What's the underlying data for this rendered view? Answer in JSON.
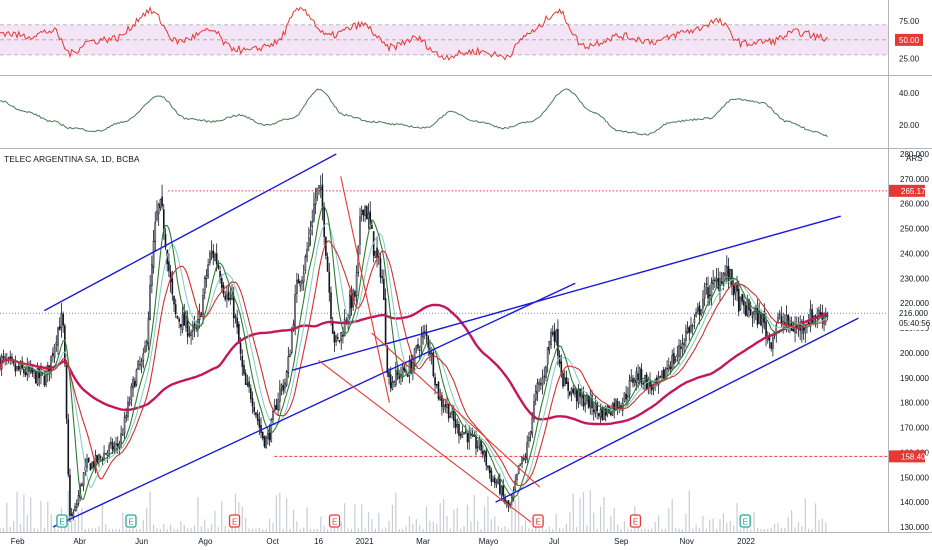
{
  "chart_data": {
    "type": "candlestick",
    "title": "TELEC ARGENTINA SA, 1D, BCBA",
    "currency": "ARS",
    "colors": {
      "up": "#26a69a",
      "down": "#131722",
      "sma_red": "#d32f2f",
      "sma_green": "#2e7d32",
      "sma_cyan": "#80cbc4",
      "sma_long": "#c2185b",
      "channel": "#1a1adb",
      "downtrend": "#e53935",
      "rsi_line": "#e53935",
      "rsi_band": "#f3e5f5",
      "adx": "#4a7a54",
      "label_red": "#e53935"
    },
    "x_axis": {
      "tick_labels": [
        "Feb",
        "Abr",
        "Jun",
        "Ago",
        "Oct",
        "16",
        "2021",
        "Mar",
        "Mayo",
        "Jul",
        "Sep",
        "Nov",
        "2022"
      ],
      "tick_positions": [
        0.02,
        0.09,
        0.16,
        0.232,
        0.308,
        0.36,
        0.412,
        0.478,
        0.552,
        0.626,
        0.702,
        0.776,
        0.843
      ]
    },
    "price_axis": {
      "ylim": [
        128,
        282
      ],
      "ticks": [
        280,
        270,
        260,
        250,
        240,
        230,
        220,
        210,
        200,
        190,
        180,
        170,
        160,
        150,
        140,
        130
      ],
      "tick_labels": [
        "280.000",
        "270.000",
        "260.000",
        "250.000",
        "240.000",
        "230.000",
        "220.000",
        "210.000",
        "200.000",
        "190.000",
        "180.000",
        "170.000",
        "160.000",
        "150.000",
        "140.000",
        "130.000"
      ]
    },
    "last_price": {
      "value": 216.0,
      "label": "216.000",
      "countdown": "05:40:56"
    },
    "levels": [
      {
        "value": 265.179,
        "label": "265.179",
        "style": "dotted"
      },
      {
        "value": 158.402,
        "label": "158.402",
        "style": "dashed"
      }
    ],
    "price_anchors": [
      [
        0.0,
        197
      ],
      [
        0.02,
        193
      ],
      [
        0.05,
        190
      ],
      [
        0.07,
        213
      ],
      [
        0.08,
        134
      ],
      [
        0.1,
        155
      ],
      [
        0.13,
        162
      ],
      [
        0.16,
        195
      ],
      [
        0.18,
        258
      ],
      [
        0.2,
        214
      ],
      [
        0.22,
        208
      ],
      [
        0.24,
        240
      ],
      [
        0.26,
        221
      ],
      [
        0.28,
        185
      ],
      [
        0.3,
        165
      ],
      [
        0.32,
        187
      ],
      [
        0.34,
        232
      ],
      [
        0.36,
        265
      ],
      [
        0.38,
        204
      ],
      [
        0.4,
        222
      ],
      [
        0.41,
        260
      ],
      [
        0.43,
        234
      ],
      [
        0.44,
        189
      ],
      [
        0.46,
        193
      ],
      [
        0.48,
        207
      ],
      [
        0.5,
        180
      ],
      [
        0.52,
        169
      ],
      [
        0.54,
        163
      ],
      [
        0.56,
        148
      ],
      [
        0.575,
        138
      ],
      [
        0.59,
        156
      ],
      [
        0.61,
        187
      ],
      [
        0.625,
        209
      ],
      [
        0.64,
        186
      ],
      [
        0.66,
        181
      ],
      [
        0.68,
        176
      ],
      [
        0.7,
        180
      ],
      [
        0.72,
        191
      ],
      [
        0.74,
        186
      ],
      [
        0.76,
        197
      ],
      [
        0.78,
        210
      ],
      [
        0.8,
        225
      ],
      [
        0.82,
        232
      ],
      [
        0.84,
        218
      ],
      [
        0.86,
        214
      ],
      [
        0.87,
        205
      ],
      [
        0.88,
        213
      ],
      [
        0.9,
        210
      ],
      [
        0.92,
        215
      ],
      [
        0.935,
        216
      ]
    ],
    "trend_lines": [
      {
        "name": "upper-channel-1",
        "from": [
          0.05,
          217
        ],
        "to": [
          0.38,
          280
        ]
      },
      {
        "name": "lower-channel-1",
        "from": [
          0.06,
          130
        ],
        "to": [
          0.65,
          228
        ]
      },
      {
        "name": "upper-channel-2",
        "from": [
          0.33,
          193
        ],
        "to": [
          0.95,
          255
        ]
      },
      {
        "name": "lower-channel-2",
        "from": [
          0.56,
          140
        ],
        "to": [
          0.97,
          214
        ]
      }
    ],
    "downtrend_lines": [
      {
        "from": [
          0.385,
          271
        ],
        "to": [
          0.44,
          180
        ]
      },
      {
        "from": [
          0.42,
          208
        ],
        "to": [
          0.61,
          146
        ]
      },
      {
        "from": [
          0.36,
          197
        ],
        "to": [
          0.6,
          132
        ]
      }
    ],
    "rsi": {
      "ticks": [
        75,
        50,
        25
      ],
      "tick_labels": [
        "75.00",
        "50.00",
        "25.00"
      ],
      "band": [
        70,
        30
      ],
      "mid": 50,
      "anchors": [
        [
          0.0,
          60
        ],
        [
          0.03,
          55
        ],
        [
          0.06,
          62
        ],
        [
          0.08,
          32
        ],
        [
          0.1,
          48
        ],
        [
          0.13,
          52
        ],
        [
          0.17,
          88
        ],
        [
          0.2,
          48
        ],
        [
          0.24,
          62
        ],
        [
          0.26,
          40
        ],
        [
          0.28,
          35
        ],
        [
          0.31,
          45
        ],
        [
          0.34,
          92
        ],
        [
          0.37,
          55
        ],
        [
          0.41,
          70
        ],
        [
          0.44,
          40
        ],
        [
          0.47,
          52
        ],
        [
          0.5,
          28
        ],
        [
          0.54,
          35
        ],
        [
          0.57,
          28
        ],
        [
          0.6,
          60
        ],
        [
          0.63,
          88
        ],
        [
          0.66,
          42
        ],
        [
          0.7,
          55
        ],
        [
          0.74,
          48
        ],
        [
          0.78,
          62
        ],
        [
          0.81,
          75
        ],
        [
          0.84,
          45
        ],
        [
          0.87,
          48
        ],
        [
          0.9,
          60
        ],
        [
          0.935,
          52
        ]
      ]
    },
    "adx": {
      "ticks": [
        40,
        20
      ],
      "tick_labels": [
        "40.00",
        "20.00"
      ],
      "anchors": [
        [
          0.0,
          35
        ],
        [
          0.03,
          28
        ],
        [
          0.06,
          22
        ],
        [
          0.08,
          18
        ],
        [
          0.11,
          16
        ],
        [
          0.14,
          22
        ],
        [
          0.18,
          38
        ],
        [
          0.21,
          24
        ],
        [
          0.24,
          22
        ],
        [
          0.27,
          26
        ],
        [
          0.3,
          20
        ],
        [
          0.33,
          24
        ],
        [
          0.36,
          42
        ],
        [
          0.39,
          26
        ],
        [
          0.42,
          22
        ],
        [
          0.45,
          20
        ],
        [
          0.48,
          18
        ],
        [
          0.51,
          28
        ],
        [
          0.54,
          22
        ],
        [
          0.57,
          18
        ],
        [
          0.6,
          22
        ],
        [
          0.64,
          42
        ],
        [
          0.67,
          28
        ],
        [
          0.7,
          16
        ],
        [
          0.73,
          14
        ],
        [
          0.76,
          22
        ],
        [
          0.8,
          24
        ],
        [
          0.83,
          36
        ],
        [
          0.86,
          34
        ],
        [
          0.89,
          22
        ],
        [
          0.92,
          16
        ],
        [
          0.935,
          13
        ]
      ]
    },
    "event_markers": [
      {
        "x": 0.07,
        "label": "E",
        "color": "#26a69a"
      },
      {
        "x": 0.148,
        "label": "E",
        "color": "#26a69a"
      },
      {
        "x": 0.265,
        "label": "E",
        "color": "#e53935"
      },
      {
        "x": 0.378,
        "label": "E",
        "color": "#e53935"
      },
      {
        "x": 0.608,
        "label": "E",
        "color": "#e53935"
      },
      {
        "x": 0.718,
        "label": "E",
        "color": "#e53935"
      },
      {
        "x": 0.842,
        "label": "E",
        "color": "#26a69a"
      }
    ]
  }
}
